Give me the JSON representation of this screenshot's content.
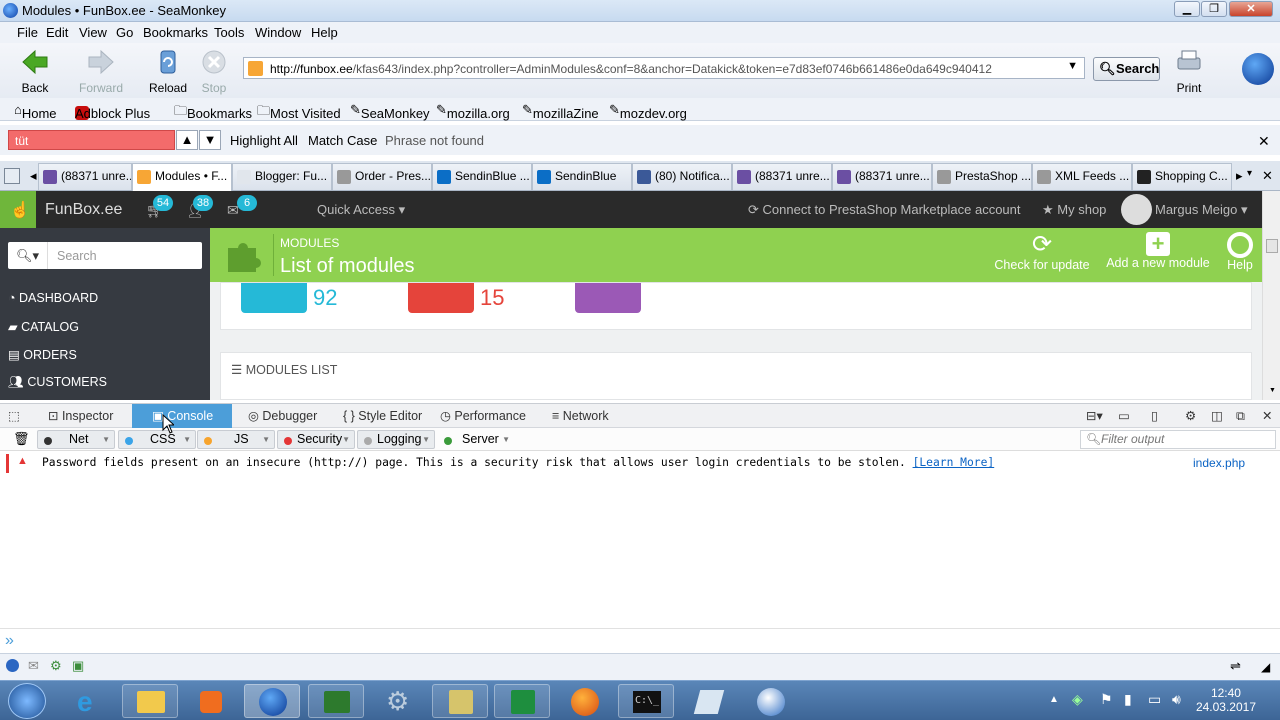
{
  "window": {
    "title": "Modules • FunBox.ee - SeaMonkey"
  },
  "menu": [
    "File",
    "Edit",
    "View",
    "Go",
    "Bookmarks",
    "Tools",
    "Window",
    "Help"
  ],
  "nav": {
    "back": "Back",
    "forward": "Forward",
    "reload": "Reload",
    "stop": "Stop",
    "print": "Print",
    "search": "Search",
    "url_domain": "http://funbox.ee",
    "url_path": "/kfas643/index.php?controller=AdminModules&conf=8&anchor=Datakick&token=e7d83ef0746b661486e0da649c940412"
  },
  "bookmarks": [
    "Home",
    "Adblock Plus",
    "Bookmarks",
    "Most Visited",
    "SeaMonkey",
    "mozilla.org",
    "mozillaZine",
    "mozdev.org"
  ],
  "find": {
    "value": "tüt",
    "highlight_all": "Highlight All",
    "match_case": "Match Case",
    "status": "Phrase not found"
  },
  "tabs": [
    "(88371 unre...",
    "Modules • F...",
    "Blogger: Fu...",
    "Order - Pres...",
    "SendinBlue ...",
    "SendinBlue",
    "(80) Notifica...",
    "(88371 unre...",
    "(88371 unre...",
    "PrestaShop ...",
    "XML Feeds ...",
    "Shopping C..."
  ],
  "ps": {
    "brand": "FunBox.ee",
    "badges": {
      "cart": "54",
      "customers": "38",
      "messages": "6"
    },
    "quick_access": "Quick Access",
    "marketplace": "Connect to PrestaShop Marketplace account",
    "my_shop": "My shop",
    "user": "Margus Meigo",
    "search_placeholder": "Search",
    "sidebar": [
      "DASHBOARD",
      "CATALOG",
      "ORDERS",
      "CUSTOMERS"
    ],
    "breadcrumb": "MODULES",
    "page_title": "List of modules",
    "actions": {
      "check": "Check for update",
      "add": "Add a new module",
      "help": "Help"
    },
    "stats": {
      "installed": "92",
      "disabled": "15"
    },
    "modules_list": "MODULES LIST"
  },
  "devtools": {
    "tabs": [
      "Inspector",
      "Console",
      "Debugger",
      "Style Editor",
      "Performance",
      "Network"
    ],
    "filters": [
      "Net",
      "CSS",
      "JS",
      "Security",
      "Logging",
      "Server"
    ],
    "filter_placeholder": "Filter output",
    "message": "Password fields present on an insecure (http://) page. This is a security risk that allows user login credentials to be stolen.",
    "learn_more": "[Learn More]",
    "source": "index.php",
    "prompt": "»"
  },
  "clock": {
    "time": "12:40",
    "date": "24.03.2017"
  },
  "colors": {
    "ps_green": "#8fd150",
    "ps_dark": "#2a2a2a",
    "console_blue": "#4c9ed9",
    "error_red": "#e43636",
    "link": "#0b63c4"
  }
}
